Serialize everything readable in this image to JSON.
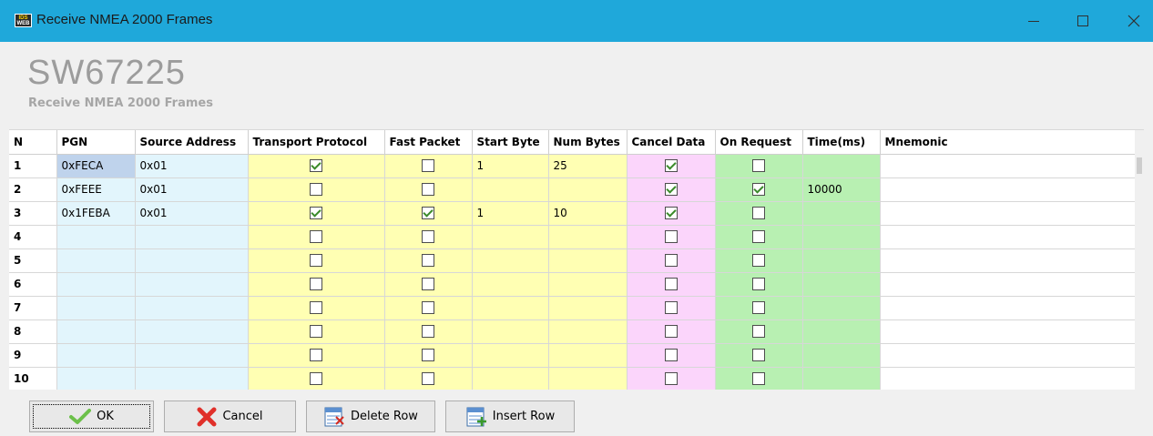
{
  "window": {
    "title": "Receive NMEA 2000 Frames",
    "icon_text_top": "IDS",
    "icon_text_bottom": "WEB"
  },
  "header": {
    "title": "SW67225",
    "subtitle": "Receive NMEA 2000 Frames"
  },
  "table": {
    "columns": [
      "N",
      "PGN",
      "Source Address",
      "Transport Protocol",
      "Fast Packet",
      "Start Byte",
      "Num Bytes",
      "Cancel Data",
      "On Request",
      "Time(ms)",
      "Mnemonic"
    ],
    "rows": [
      {
        "n": "1",
        "pgn": "0xFECA",
        "source": "0x01",
        "transport": true,
        "fast": false,
        "start": "1",
        "num": "25",
        "cancel": true,
        "onreq": false,
        "time": "",
        "mnemonic": ""
      },
      {
        "n": "2",
        "pgn": "0xFEEE",
        "source": "0x01",
        "transport": false,
        "fast": false,
        "start": "",
        "num": "",
        "cancel": true,
        "onreq": true,
        "time": "10000",
        "mnemonic": ""
      },
      {
        "n": "3",
        "pgn": "0x1FEBA",
        "source": "0x01",
        "transport": true,
        "fast": true,
        "start": "1",
        "num": "10",
        "cancel": true,
        "onreq": false,
        "time": "",
        "mnemonic": ""
      },
      {
        "n": "4",
        "pgn": "",
        "source": "",
        "transport": false,
        "fast": false,
        "start": "",
        "num": "",
        "cancel": false,
        "onreq": false,
        "time": "",
        "mnemonic": ""
      },
      {
        "n": "5",
        "pgn": "",
        "source": "",
        "transport": false,
        "fast": false,
        "start": "",
        "num": "",
        "cancel": false,
        "onreq": false,
        "time": "",
        "mnemonic": ""
      },
      {
        "n": "6",
        "pgn": "",
        "source": "",
        "transport": false,
        "fast": false,
        "start": "",
        "num": "",
        "cancel": false,
        "onreq": false,
        "time": "",
        "mnemonic": ""
      },
      {
        "n": "7",
        "pgn": "",
        "source": "",
        "transport": false,
        "fast": false,
        "start": "",
        "num": "",
        "cancel": false,
        "onreq": false,
        "time": "",
        "mnemonic": ""
      },
      {
        "n": "8",
        "pgn": "",
        "source": "",
        "transport": false,
        "fast": false,
        "start": "",
        "num": "",
        "cancel": false,
        "onreq": false,
        "time": "",
        "mnemonic": ""
      },
      {
        "n": "9",
        "pgn": "",
        "source": "",
        "transport": false,
        "fast": false,
        "start": "",
        "num": "",
        "cancel": false,
        "onreq": false,
        "time": "",
        "mnemonic": ""
      },
      {
        "n": "10",
        "pgn": "",
        "source": "",
        "transport": false,
        "fast": false,
        "start": "",
        "num": "",
        "cancel": false,
        "onreq": false,
        "time": "",
        "mnemonic": ""
      }
    ]
  },
  "buttons": {
    "ok": "OK",
    "cancel": "Cancel",
    "delete_row": "Delete Row",
    "insert_row": "Insert Row"
  },
  "colors": {
    "titlebar": "#1fa8da",
    "source_col": "#e2f5fc",
    "yellow_cols": "#ffffb3",
    "pink_col": "#fbd5fb",
    "green_cols": "#b8f0b2"
  },
  "icons": [
    "app-icon",
    "minimize-icon",
    "maximize-icon",
    "close-icon",
    "ok-check-icon",
    "cancel-x-icon",
    "delete-row-icon",
    "insert-row-icon"
  ]
}
